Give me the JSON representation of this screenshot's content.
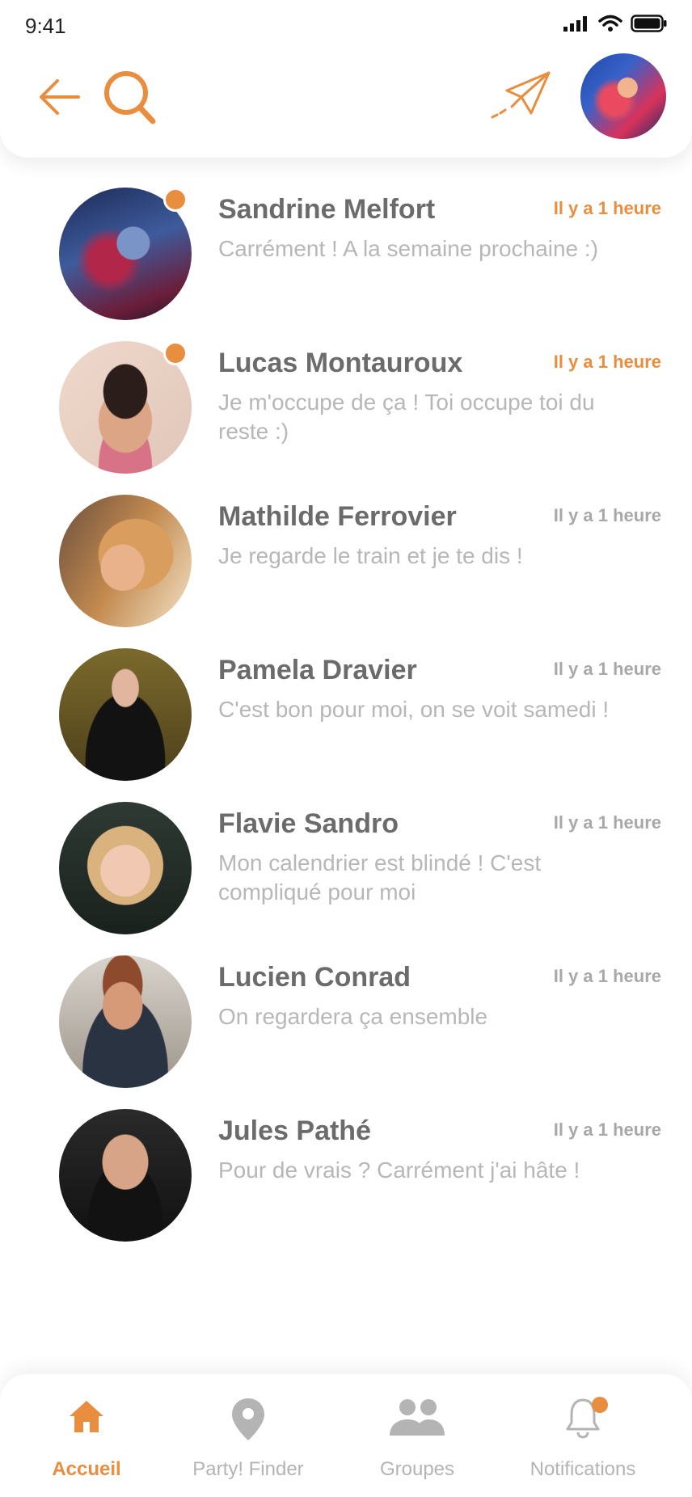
{
  "status_bar": {
    "time": "9:41",
    "icons": [
      "signal-icon",
      "wifi-icon",
      "battery-icon"
    ]
  },
  "header": {
    "icons": [
      "back-arrow-icon",
      "search-icon",
      "send-icon"
    ],
    "profile_avatar": "user-avatar"
  },
  "colors": {
    "accent": "#e98d3e",
    "name": "#6b6b6b",
    "message": "#b7b7b7",
    "time_read": "#a8a8a8"
  },
  "conversations": [
    {
      "name": "Sandrine Melfort",
      "time": "Il y a 1 heure",
      "message": "Carrément ! A la semaine prochaine :)",
      "unread": true
    },
    {
      "name": "Lucas Montauroux",
      "time": "Il y a 1 heure",
      "message": "Je m'occupe de ça ! Toi occupe toi du reste :)",
      "unread": true
    },
    {
      "name": "Mathilde Ferrovier",
      "time": "Il y a 1 heure",
      "message": "Je regarde le train et je te dis !",
      "unread": false
    },
    {
      "name": "Pamela Dravier",
      "time": "Il y a 1 heure",
      "message": "C'est bon pour moi, on se voit samedi !",
      "unread": false
    },
    {
      "name": "Flavie Sandro",
      "time": "Il y a 1 heure",
      "message": "Mon calendrier est blindé ! C'est compliqué pour moi",
      "unread": false
    },
    {
      "name": "Lucien Conrad",
      "time": "Il y a 1 heure",
      "message": "On regardera ça ensemble",
      "unread": false
    },
    {
      "name": "Jules Pathé",
      "time": "Il y a 1 heure",
      "message": "Pour de vrais ? Carrément j'ai hâte !",
      "unread": false
    }
  ],
  "bottom_nav": [
    {
      "label": "Accueil",
      "icon": "home-icon",
      "active": true
    },
    {
      "label": "Party! Finder",
      "icon": "location-pin-icon",
      "active": false
    },
    {
      "label": "Groupes",
      "icon": "group-icon",
      "active": false
    },
    {
      "label": "Notifications",
      "icon": "bell-icon",
      "active": false,
      "badge": true
    }
  ]
}
